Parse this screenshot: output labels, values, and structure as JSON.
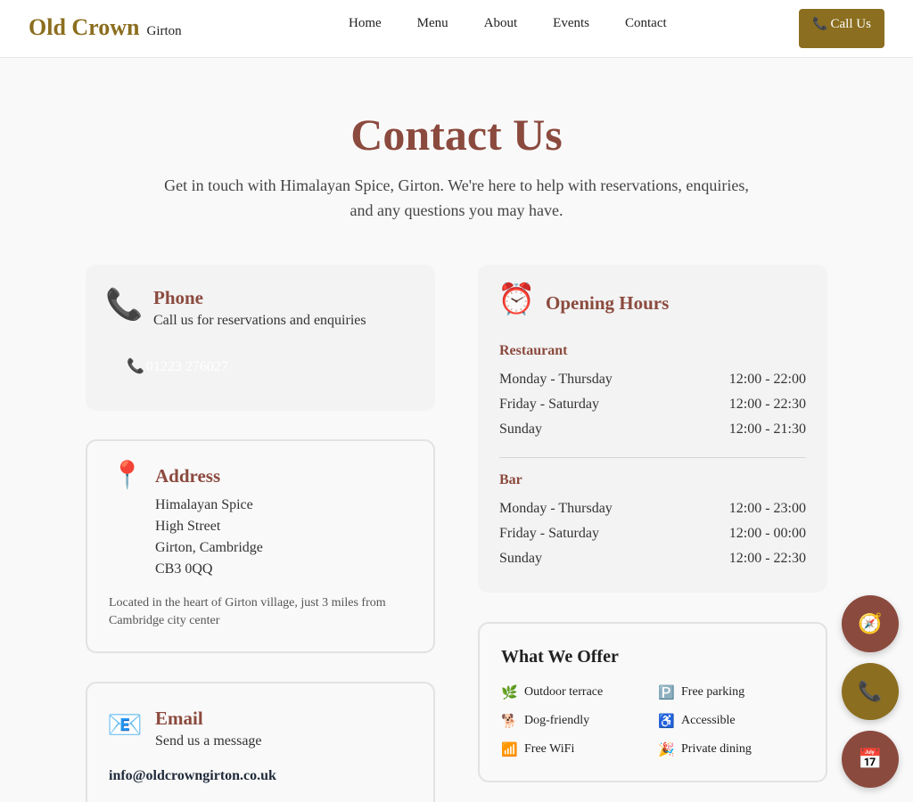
{
  "nav": {
    "brand": "Old Crown",
    "brand_sub": "Girton",
    "links": [
      "Home",
      "Menu",
      "About",
      "Events",
      "Contact"
    ],
    "call_label": "Call Us",
    "call_icon": "phone-icon"
  },
  "hero": {
    "title": "Contact Us",
    "text": "Get in touch with Himalayan Spice, Girton. We're here to help with reservations, enquiries, and any questions you may have."
  },
  "phone": {
    "icon": "telephone-icon",
    "title": "Phone",
    "subtitle": "Call us for reservations and enquiries",
    "number": "01223 276027"
  },
  "address": {
    "icon": "pushpin-icon",
    "title": "Address",
    "lines": [
      "Himalayan Spice",
      "High Street",
      "Girton, Cambridge",
      "CB3 0QQ"
    ],
    "note": "Located in the heart of Girton village, just 3 miles from Cambridge city center"
  },
  "email": {
    "icon": "envelope-icon",
    "title": "Email",
    "subtitle": "Send us a message",
    "address": "info@oldcrowngirton.co.uk"
  },
  "hours": {
    "icon": "alarm-clock-icon",
    "title": "Opening Hours",
    "sections": [
      {
        "name": "Restaurant",
        "rows": [
          {
            "day": "Monday - Thursday",
            "time": "12:00 - 22:00"
          },
          {
            "day": "Friday - Saturday",
            "time": "12:00 - 22:30"
          },
          {
            "day": "Sunday",
            "time": "12:00 - 21:30"
          }
        ]
      },
      {
        "name": "Bar",
        "rows": [
          {
            "day": "Monday - Thursday",
            "time": "12:00 - 23:00"
          },
          {
            "day": "Friday - Saturday",
            "time": "12:00 - 00:00"
          },
          {
            "day": "Sunday",
            "time": "12:00 - 22:30"
          }
        ]
      }
    ]
  },
  "offer": {
    "title": "What We Offer",
    "items": [
      {
        "icon": "herb-icon",
        "label": "Outdoor terrace"
      },
      {
        "icon": "parking-icon",
        "label": "Free parking"
      },
      {
        "icon": "dog-icon",
        "label": "Dog-friendly"
      },
      {
        "icon": "wheelchair-icon",
        "label": "Accessible"
      },
      {
        "icon": "signal-icon",
        "label": "Free WiFi"
      },
      {
        "icon": "party-popper-icon",
        "label": "Private dining"
      }
    ]
  },
  "fabs": [
    {
      "icon": "compass-icon",
      "name": "directions"
    },
    {
      "icon": "phone-icon",
      "name": "call"
    },
    {
      "icon": "calendar-icon",
      "name": "book"
    }
  ],
  "colors": {
    "brand_gold": "#8b6e1f",
    "accent_red": "#8b4a3e",
    "background": "#f9f9f9"
  }
}
